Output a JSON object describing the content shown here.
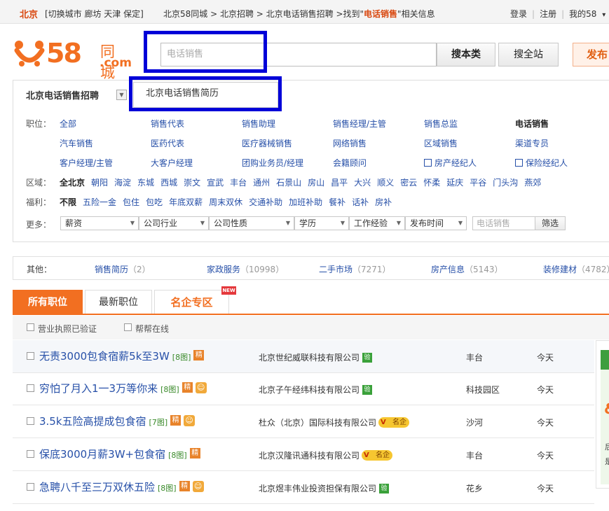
{
  "topbar": {
    "city": "北京",
    "city_links": "[切换城市  廊坊  天津  保定]",
    "crumbs_prefix": "北京58同城 > 北京招聘 > 北京电话销售招聘 >找到\"",
    "crumbs_keyword": "电话销售",
    "crumbs_suffix": "\"相关信息",
    "login": "登录",
    "register": "注册",
    "my58": "我的58",
    "my58_arrow": "▾"
  },
  "logo": {
    "number": "58",
    "cn": "同城",
    "com": ".com"
  },
  "search": {
    "placeholder": "电话销售",
    "btn_this": "搜本类",
    "btn_all": "搜全站",
    "btn_post": "发布"
  },
  "category": {
    "title": "北京电话销售招聘",
    "dropdown_arrow": "▼",
    "dropdown_item": "北京电话销售简历"
  },
  "rows": {
    "zhiwei_label": "职位：",
    "zhiwei_row1": [
      "全部",
      "销售代表",
      "销售助理",
      "销售经理/主管",
      "销售总监",
      "电话销售"
    ],
    "zhiwei_row2": [
      "汽车销售",
      "医药代表",
      "医疗器械销售",
      "网络销售",
      "区域销售",
      "渠道专员"
    ],
    "zhiwei_row3": [
      "客户经理/主管",
      "大客户经理",
      "团购业务员/经理",
      "会籍顾问",
      "房产经纪人",
      "保险经纪人"
    ],
    "quyu_label": "区域：",
    "quyu": [
      "全北京",
      "朝阳",
      "海淀",
      "东城",
      "西城",
      "崇文",
      "宣武",
      "丰台",
      "通州",
      "石景山",
      "房山",
      "昌平",
      "大兴",
      "顺义",
      "密云",
      "怀柔",
      "延庆",
      "平谷",
      "门头沟",
      "燕郊"
    ],
    "fuli_label": "福利：",
    "fuli": [
      "不限",
      "五险一金",
      "包住",
      "包吃",
      "年底双薪",
      "周末双休",
      "交通补助",
      "加班补助",
      "餐补",
      "话补",
      "房补"
    ],
    "more_label": "更多：",
    "selects": [
      "薪资",
      "公司行业",
      "公司性质",
      "学历",
      "工作经验",
      "发布时间"
    ],
    "select_arrow": "▼",
    "filter_placeholder": "电话销售",
    "filter_btn": "筛选"
  },
  "other": {
    "label": "其他：",
    "items": [
      {
        "name": "销售简历",
        "count": "（2）"
      },
      {
        "name": "家政服务",
        "count": "（10998）"
      },
      {
        "name": "二手市场",
        "count": "（7271）"
      },
      {
        "name": "房产信息",
        "count": "（5143）"
      },
      {
        "name": "装修建材",
        "count": "（4782）"
      }
    ]
  },
  "tabs": {
    "all": "所有职位",
    "latest": "最新职位",
    "brand": "名企专区",
    "new_badge": "NEW"
  },
  "filters": {
    "license": "营业执照已验证",
    "online": "帮帮在线"
  },
  "badges": {
    "jing": "精",
    "yan": "验",
    "mingqi": "名企",
    "smile": "☺"
  },
  "jobs": [
    {
      "title": "无责3000包食宿薪5k至3W",
      "pics": "[8图]",
      "company": "北京世纪威联科技有限公司",
      "area": "丰台",
      "time": "今天"
    },
    {
      "title": "穷怕了月入1一3万等你来",
      "pics": "[8图]",
      "company": "北京子午经纬科技有限公司",
      "area": "科技园区",
      "time": "今天"
    },
    {
      "title": "3.5k五险高提成包食宿",
      "pics": "[7图]",
      "company": "杜众（北京）国际科技有限公司",
      "area": "沙河",
      "time": "今天"
    },
    {
      "title": "保底3000月薪3W+包食宿",
      "pics": "[8图]",
      "company": "北京汉隆讯通科技有限公司",
      "area": "丰台",
      "time": "今天"
    },
    {
      "title": "急聘八千至三万双休五险",
      "pics": "[8图]",
      "company": "北京煜丰伟业投资担保有限公司",
      "area": "花乡",
      "time": "今天"
    }
  ],
  "side_ad": {
    "symbol": "&",
    "t1": "后",
    "t2": "是"
  },
  "colors": {
    "accent": "#f26f21",
    "link": "#2750a8",
    "highlight_box": "#0000d8"
  }
}
